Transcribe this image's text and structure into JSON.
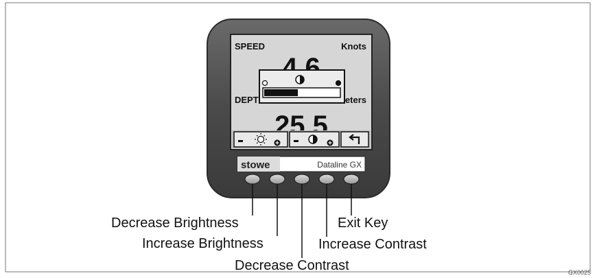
{
  "screen": {
    "speed_label": "SPEED",
    "speed_unit": "Knots",
    "speed_value": "4.6",
    "depth_label": "DEPT",
    "depth_unit": "eters",
    "depth_value": "25.5",
    "contrast_level": 0.45
  },
  "softkeys": [
    {
      "icon": "brightness-sun-icon"
    },
    {
      "icon": "contrast-icon"
    },
    {
      "icon": "return-arrow-icon"
    }
  ],
  "brand": {
    "logo": "stowe",
    "model": "Dataline GX"
  },
  "callouts": {
    "decrease_brightness": "Decrease Brightness",
    "increase_brightness": "Increase Brightness",
    "decrease_contrast": "Decrease Contrast",
    "increase_contrast": "Increase Contrast",
    "exit_key": "Exit Key"
  },
  "figure_code": "GX0025",
  "colors": {
    "bezel": "#4a4a4a",
    "screen": "#d6d6d6",
    "ink": "#111111"
  }
}
